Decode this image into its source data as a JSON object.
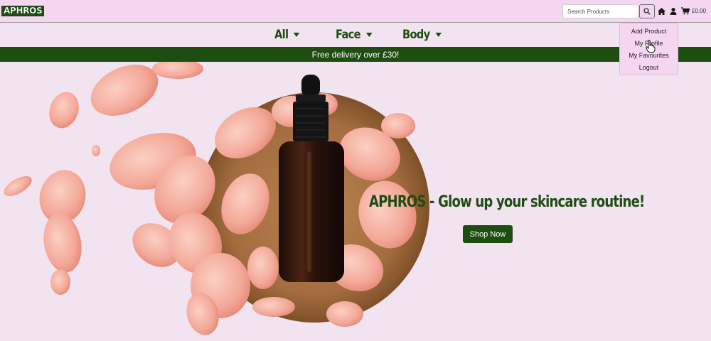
{
  "header": {
    "logo": "APHROS",
    "search": {
      "placeholder": "Search Products",
      "value": ""
    },
    "cart_total": "£0.00"
  },
  "nav": {
    "items": [
      {
        "label": "All"
      },
      {
        "label": "Face"
      },
      {
        "label": "Body"
      }
    ]
  },
  "banner": {
    "text": "Free delivery over £30!"
  },
  "hero": {
    "title": "APHROS - Glow up your skincare routine!",
    "cta_label": "Shop Now"
  },
  "account_menu": {
    "items": [
      {
        "label": "Add Product"
      },
      {
        "label": "My Profile"
      },
      {
        "label": "My Favourites"
      },
      {
        "label": "Logout"
      }
    ]
  },
  "colors": {
    "brand_green": "#1e4d12",
    "header_pink": "#f5d6f0",
    "page_pink": "#f2e3f1"
  },
  "icons": [
    "search-icon",
    "home-icon",
    "user-icon",
    "cart-icon",
    "pointer-cursor-icon"
  ]
}
